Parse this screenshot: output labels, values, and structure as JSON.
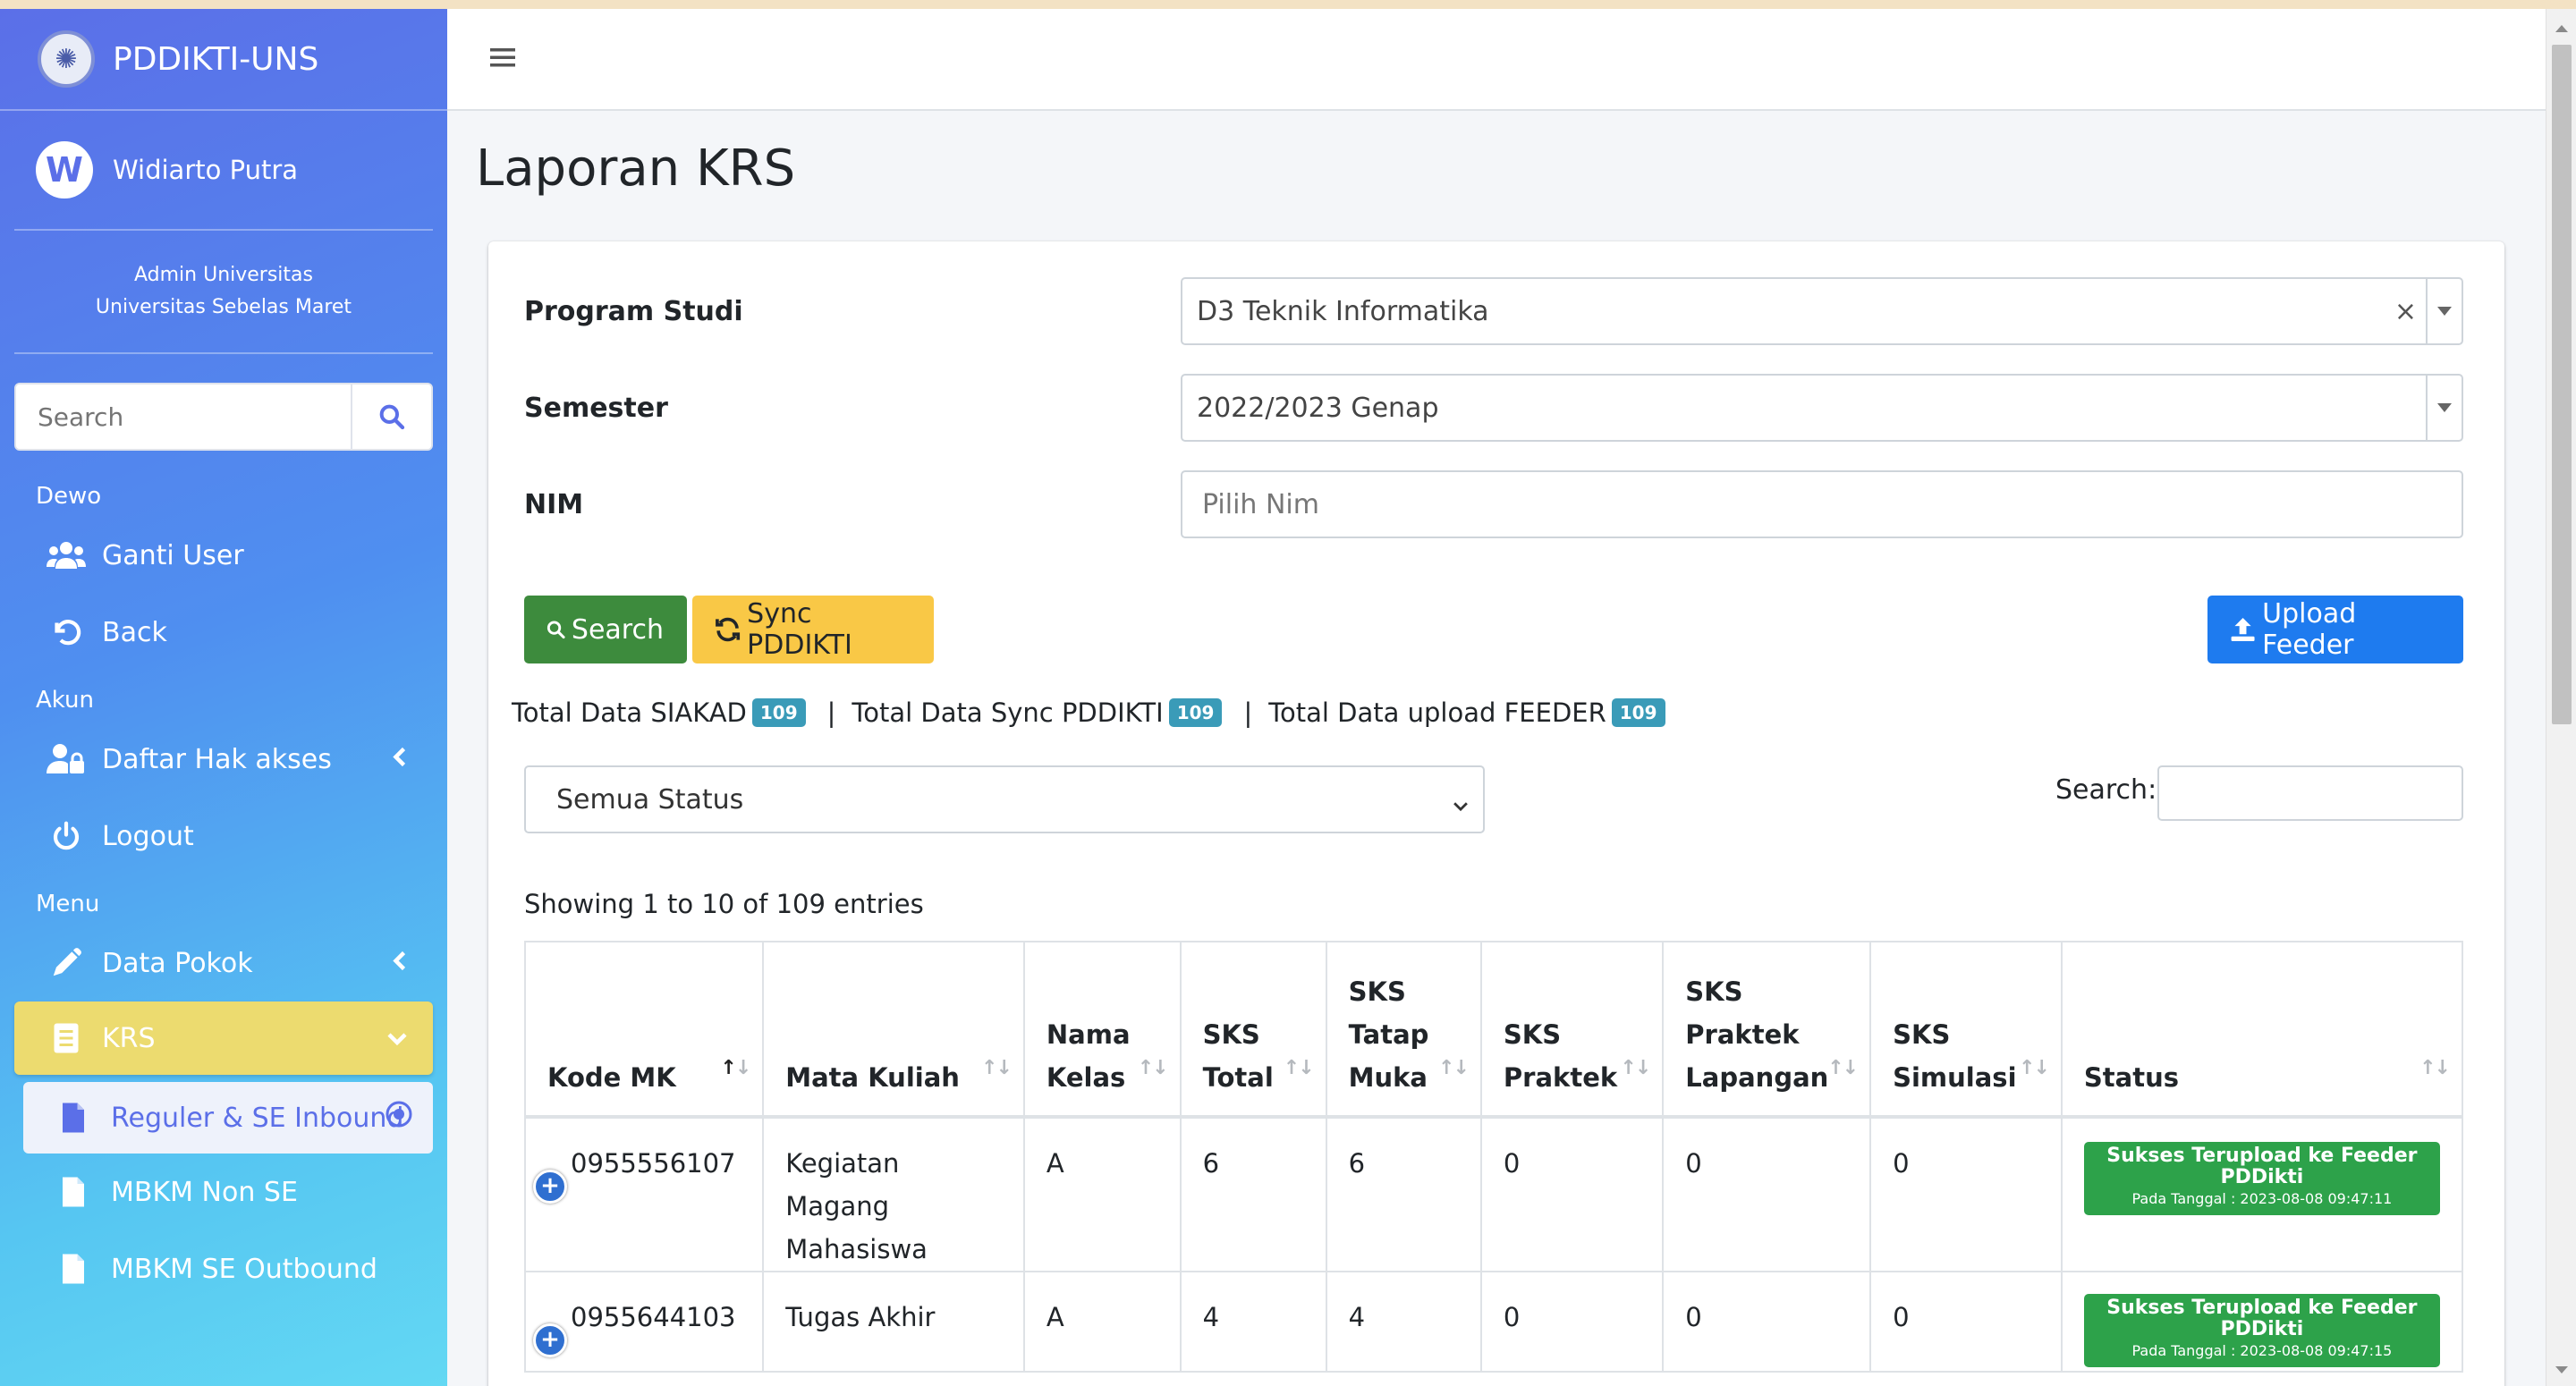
{
  "brand": {
    "name": "PDDIKTI-UNS"
  },
  "user": {
    "initial": "W",
    "name": "Widiarto Putra",
    "role": "Admin Universitas",
    "institution": "Universitas Sebelas Maret"
  },
  "sidebar_search": {
    "placeholder": "Search"
  },
  "sidebar": {
    "sections": [
      {
        "header": "Dewo",
        "items": [
          {
            "label": "Ganti User",
            "icon": "users-icon"
          },
          {
            "label": "Back",
            "icon": "undo-icon"
          }
        ]
      },
      {
        "header": "Akun",
        "items": [
          {
            "label": "Daftar Hak akses",
            "icon": "user-lock-icon"
          },
          {
            "label": "Logout",
            "icon": "power-icon"
          }
        ]
      },
      {
        "header": "Menu",
        "items": [
          {
            "label": "Data Pokok",
            "icon": "pen-icon"
          },
          {
            "label": "KRS",
            "icon": "book-icon",
            "active": true
          }
        ]
      }
    ],
    "krs_sub": [
      "Reguler & SE Inbound",
      "MBKM Non SE",
      "MBKM SE Outbound"
    ]
  },
  "page": {
    "title": "Laporan KRS"
  },
  "form": {
    "prodi_label": "Program Studi",
    "prodi_value": "D3 Teknik Informatika",
    "semester_label": "Semester",
    "semester_value": "2022/2023 Genap",
    "nim_label": "NIM",
    "nim_placeholder": "Pilih Nim"
  },
  "buttons": {
    "search": "Search",
    "sync": "Sync PDDIKTI",
    "upload": "Upload Feeder"
  },
  "totals": {
    "siakad_label": "Total Data SIAKAD",
    "siakad": "109",
    "sync_label": "Total Data Sync PDDIKTI",
    "sync": "109",
    "feeder_label": "Total Data upload FEEDER",
    "feeder": "109",
    "separator": "|"
  },
  "filter": {
    "status_value": "Semua Status",
    "search_label": "Search:"
  },
  "showing": "Showing 1 to 10 of 109 entries",
  "table": {
    "headers": [
      [
        "Kode MK"
      ],
      [
        "Mata Kuliah"
      ],
      [
        "Nama",
        "Kelas"
      ],
      [
        "SKS",
        "Total"
      ],
      [
        "SKS",
        "Tatap",
        "Muka"
      ],
      [
        "SKS",
        "Praktek"
      ],
      [
        "SKS",
        "Praktek",
        "Lapangan"
      ],
      [
        "SKS",
        "Simulasi"
      ],
      [
        "Status"
      ]
    ],
    "rows": [
      {
        "kode": "0955556107",
        "mk1": "Kegiatan Magang",
        "mk2": "Mahasiswa",
        "kelas": "A",
        "total": "6",
        "tatap": "6",
        "praktek": "0",
        "lapangan": "0",
        "simulasi": "0",
        "status": "Sukses Terupload ke Feeder PDDikti",
        "tanggal": "Pada Tanggal : 2023-08-08 09:47:11"
      },
      {
        "kode": "0955644103",
        "mk1": "Tugas Akhir",
        "mk2": "",
        "kelas": "A",
        "total": "4",
        "tatap": "4",
        "praktek": "0",
        "lapangan": "0",
        "simulasi": "0",
        "status": "Sukses Terupload ke Feeder PDDikti",
        "tanggal": "Pada Tanggal : 2023-08-08 09:47:15"
      }
    ]
  },
  "colors": {
    "accent_green": "#3d8b3d",
    "accent_yellow": "#f9c846",
    "accent_blue": "#1e7bef",
    "active_menu": "#ecdb6f",
    "badge_teal": "#3a9bb8"
  }
}
